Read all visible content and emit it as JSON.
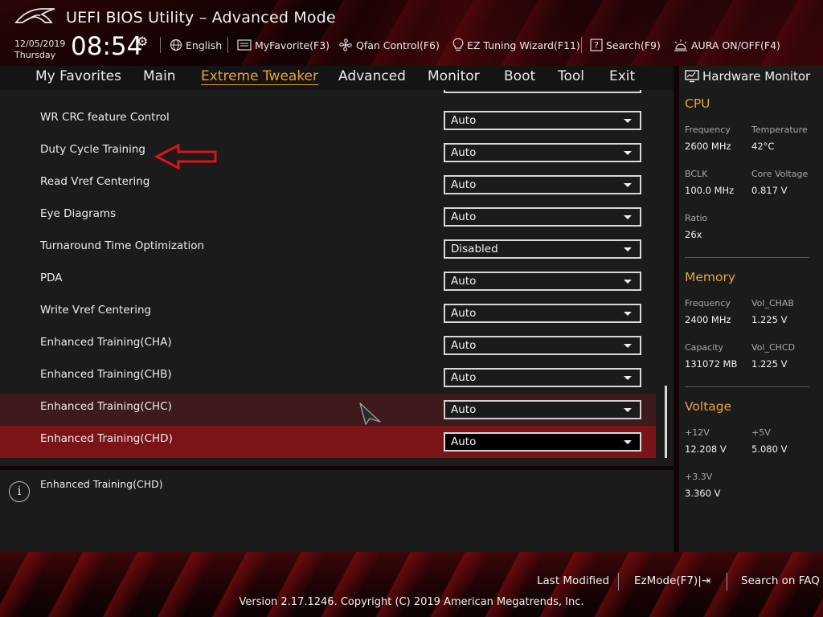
{
  "header": {
    "title": "UEFI BIOS Utility – Advanced Mode",
    "date": "12/05/2019",
    "day": "Thursday",
    "time": "08:54",
    "items": {
      "language": "English",
      "favorite": "MyFavorite(F3)",
      "qfan": "Qfan Control(F6)",
      "ez_tuning": "EZ Tuning Wizard(F11)",
      "search": "Search(F9)",
      "aura": "AURA ON/OFF(F4)"
    }
  },
  "menu": {
    "items": [
      "My Favorites",
      "Main",
      "Extreme Tweaker",
      "Advanced",
      "Monitor",
      "Boot",
      "Tool",
      "Exit"
    ],
    "active": "Extreme Tweaker"
  },
  "settings": [
    {
      "label": "WR CRC feature Control",
      "value": "Auto"
    },
    {
      "label": "Duty Cycle Training",
      "value": "Auto"
    },
    {
      "label": "Read Vref Centering",
      "value": "Auto"
    },
    {
      "label": "Eye Diagrams",
      "value": "Auto"
    },
    {
      "label": "Turnaround Time Optimization",
      "value": "Disabled"
    },
    {
      "label": "PDA",
      "value": "Auto"
    },
    {
      "label": "Write Vref Centering",
      "value": "Auto"
    },
    {
      "label": "Enhanced Training(CHA)",
      "value": "Auto"
    },
    {
      "label": "Enhanced Training(CHB)",
      "value": "Auto"
    },
    {
      "label": "Enhanced Training(CHC)",
      "value": "Auto"
    },
    {
      "label": "Enhanced Training(CHD)",
      "value": "Auto"
    }
  ],
  "help_text": "Enhanced Training(CHD)",
  "hardware_monitor": {
    "title": "Hardware Monitor",
    "cpu": {
      "section": "CPU",
      "frequency_label": "Frequency",
      "frequency": "2600 MHz",
      "temperature_label": "Temperature",
      "temperature": "42°C",
      "bclk_label": "BCLK",
      "bclk": "100.0 MHz",
      "core_voltage_label": "Core Voltage",
      "core_voltage": "0.817 V",
      "ratio_label": "Ratio",
      "ratio": "26x"
    },
    "memory": {
      "section": "Memory",
      "frequency_label": "Frequency",
      "frequency": "2400 MHz",
      "vol_chab_label": "Vol_CHAB",
      "vol_chab": "1.225 V",
      "capacity_label": "Capacity",
      "capacity": "131072 MB",
      "vol_chcd_label": "Vol_CHCD",
      "vol_chcd": "1.225 V"
    },
    "voltage": {
      "section": "Voltage",
      "v12_label": "+12V",
      "v12": "12.208 V",
      "v5_label": "+5V",
      "v5": "5.080 V",
      "v33_label": "+3.3V",
      "v33": "3.360 V"
    }
  },
  "footer": {
    "last_modified": "Last Modified",
    "ezmode": "EzMode(F7)|⇥",
    "search_faq": "Search on FAQ",
    "copyright": "Version 2.17.1246. Copyright (C) 2019 American Megatrends, Inc."
  },
  "colors": {
    "accent": "#e8a33a",
    "highlight_row": "#7a1418",
    "hover_row": "#3d1a1c",
    "annotation_arrow": "#d8141c"
  }
}
